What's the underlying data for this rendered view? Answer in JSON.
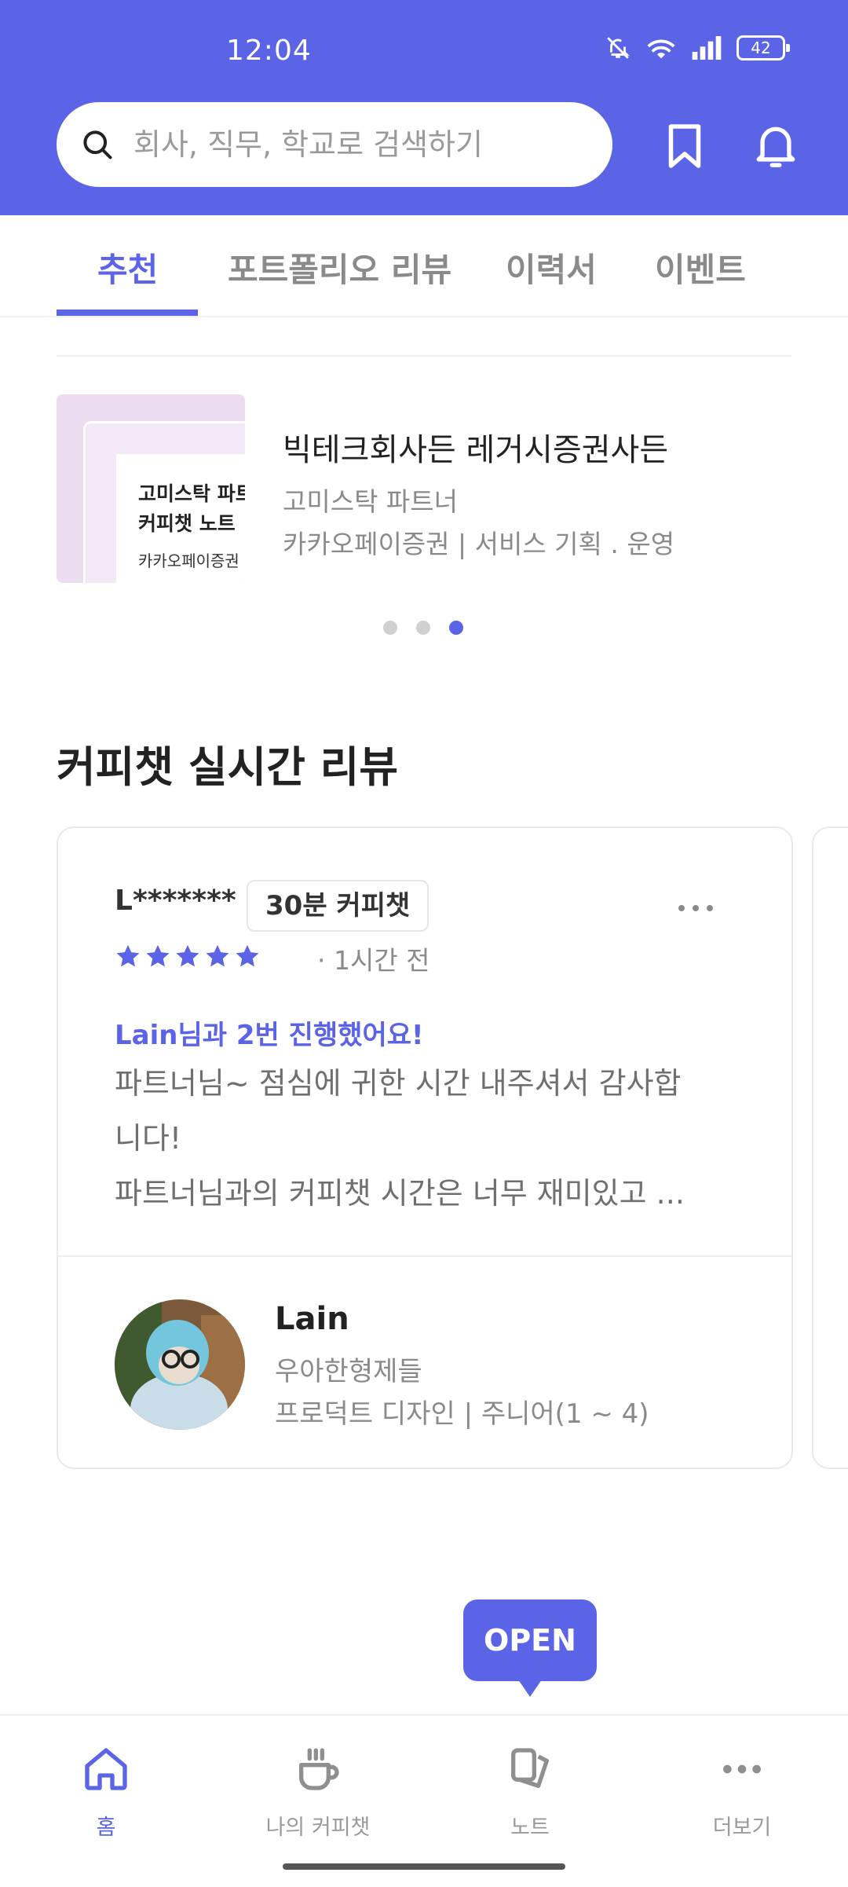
{
  "status_bar": {
    "time": "12:04",
    "battery": "42"
  },
  "search": {
    "placeholder": "회사, 직무, 학교로 검색하기"
  },
  "tabs": [
    {
      "label": "추천",
      "active": true
    },
    {
      "label": "포트폴리오 리뷰"
    },
    {
      "label": "이력서"
    },
    {
      "label": "이벤트"
    }
  ],
  "carousel": {
    "thumbnail": {
      "line1": "고미스탁 파트너",
      "line2": "커피챗 노트",
      "line3": "카카오페이증권"
    },
    "title": "빅테크회사든 레거시증권사든",
    "subtitle": "고미스탁 파트너",
    "meta": "카카오페이증권 | 서비스 기획 . 운영",
    "pages": 3,
    "current_page": 3
  },
  "section": {
    "title": "커피챗 실시간 리뷰"
  },
  "review": {
    "reviewer": "L*******",
    "badge": "30분 커피챗",
    "rating": 5,
    "time_ago": "· 1시간 전",
    "highlight": "Lain님과 2번 진행했어요!",
    "text_lines": [
      "파트너님~ 점심에 귀한 시간 내주셔서 감사합",
      "니다!",
      "파트너님과의 커피챗 시간은 너무 재미있고 ..."
    ],
    "partner": {
      "name": "Lain",
      "company": "우아한형제들",
      "role": "프로덕트 디자인 | 주니어(1 ~ 4)"
    }
  },
  "open_bubble": "OPEN",
  "bottom_nav": [
    {
      "label": "홈",
      "icon": "home-icon",
      "active": true
    },
    {
      "label": "나의 커피챗",
      "icon": "coffee-cup-icon"
    },
    {
      "label": "노트",
      "icon": "note-icon"
    },
    {
      "label": "더보기",
      "icon": "more-icon"
    }
  ],
  "colors": {
    "primary": "#5b64e6",
    "text": "#222222",
    "muted": "#8a8a8a"
  }
}
